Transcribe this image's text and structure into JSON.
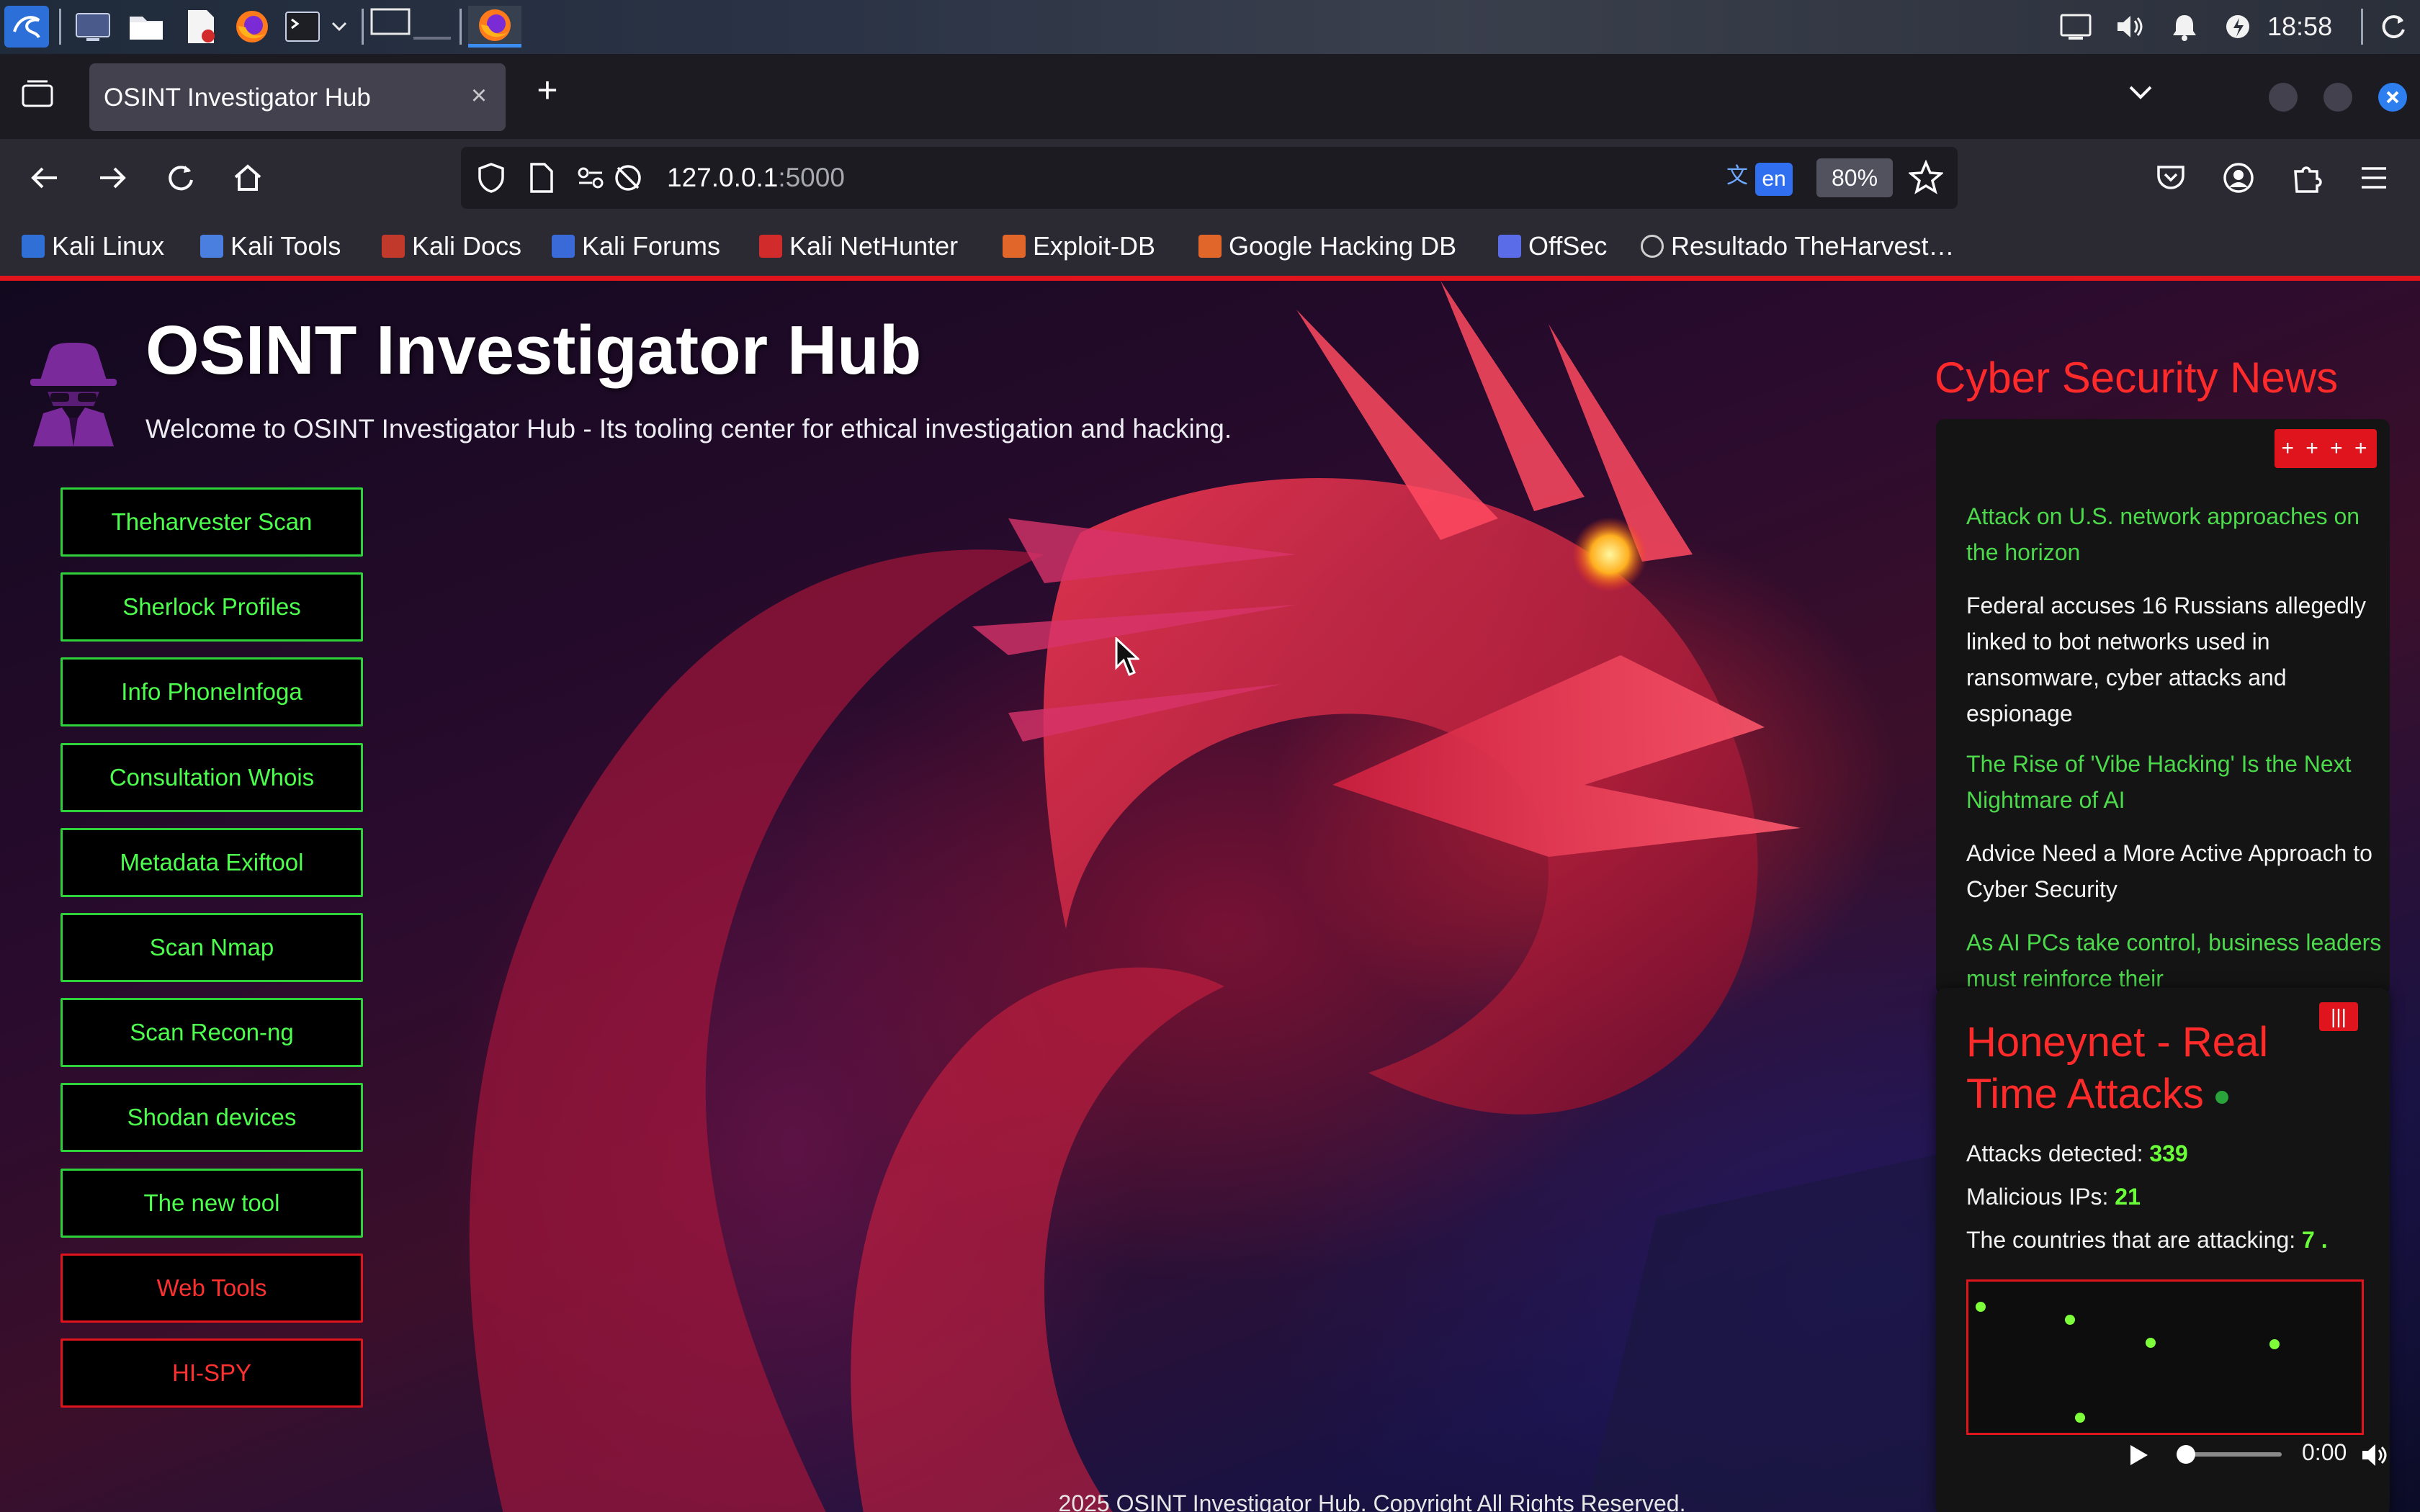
{
  "taskbar": {
    "clock": "18:58",
    "icons": [
      "kali-menu-icon",
      "desktop-icon",
      "files-icon",
      "text-editor-icon",
      "firefox-icon",
      "terminal-icon",
      "chevron-down-icon",
      "workspace-1",
      "workspace-2",
      "firefox-window-icon"
    ],
    "tray": [
      "display-icon",
      "volume-icon",
      "notification-bell-icon",
      "power-icon",
      "refresh-icon"
    ]
  },
  "browser": {
    "tab_title": "OSINT Investigator Hub",
    "tab_close": "×",
    "new_tab": "+",
    "url_host": "127.0.0.1",
    "url_port": ":5000",
    "translate_lang": "en",
    "zoom": "80%"
  },
  "bookmarks": [
    {
      "label": "Kali Linux",
      "color": "#2f6fd6"
    },
    {
      "label": "Kali Tools",
      "color": "#4a7fe0"
    },
    {
      "label": "Kali Docs",
      "color": "#c0392b"
    },
    {
      "label": "Kali Forums",
      "color": "#3a6ad8"
    },
    {
      "label": "Kali NetHunter",
      "color": "#d12b2b"
    },
    {
      "label": "Exploit-DB",
      "color": "#e0662a"
    },
    {
      "label": "Google Hacking DB",
      "color": "#e0662a"
    },
    {
      "label": "OffSec",
      "color": "#5b6ce8"
    },
    {
      "label": "Resultado TheHarvest…",
      "color": "#cfcfcf"
    }
  ],
  "page": {
    "title": "OSINT Investigator Hub",
    "subtitle": "Welcome to OSINT Investigator Hub - Its tooling center for ethical investigation and hacking.",
    "footer": "2025 OSINT Investigator Hub. Copyright All Rights Reserved."
  },
  "tools": [
    {
      "label": "Theharvester Scan",
      "style": "green"
    },
    {
      "label": "Sherlock Profiles",
      "style": "green"
    },
    {
      "label": "Info PhoneInfoga",
      "style": "green"
    },
    {
      "label": "Consultation Whois",
      "style": "green"
    },
    {
      "label": "Metadata Exiftool",
      "style": "green"
    },
    {
      "label": "Scan Nmap",
      "style": "green"
    },
    {
      "label": "Scan Recon-ng",
      "style": "green"
    },
    {
      "label": "Shodan devices",
      "style": "green"
    },
    {
      "label": "The new tool",
      "style": "green"
    },
    {
      "label": "Web Tools",
      "style": "red"
    },
    {
      "label": "HI-SPY",
      "style": "red"
    }
  ],
  "news": {
    "heading": "Cyber Security News",
    "toggle_label": "+ + + +",
    "items": [
      {
        "text": "Attack on U.S. network approaches on the horizon",
        "color": "green"
      },
      {
        "text": "Federal accuses 16 Russians allegedly linked to bot networks used in ransomware, cyber attacks and espionage",
        "color": "white"
      },
      {
        "text": "The Rise of 'Vibe Hacking' Is the Next Nightmare of AI",
        "color": "green"
      },
      {
        "text": "Advice Need a More Active Approach to Cyber Security",
        "color": "white"
      },
      {
        "text": "As AI PCs take control, business leaders must reinforce their",
        "color": "green"
      }
    ]
  },
  "honeynet": {
    "close_label": "|||",
    "title": "Honeynet - Real Time Attacks",
    "attacks_label": "Attacks detected: ",
    "attacks_value": "339",
    "ips_label": "Malicious IPs: ",
    "ips_value": "21",
    "countries_label": "The countries that are attacking: ",
    "countries_value": "7 .",
    "audio_time": "0:00"
  }
}
